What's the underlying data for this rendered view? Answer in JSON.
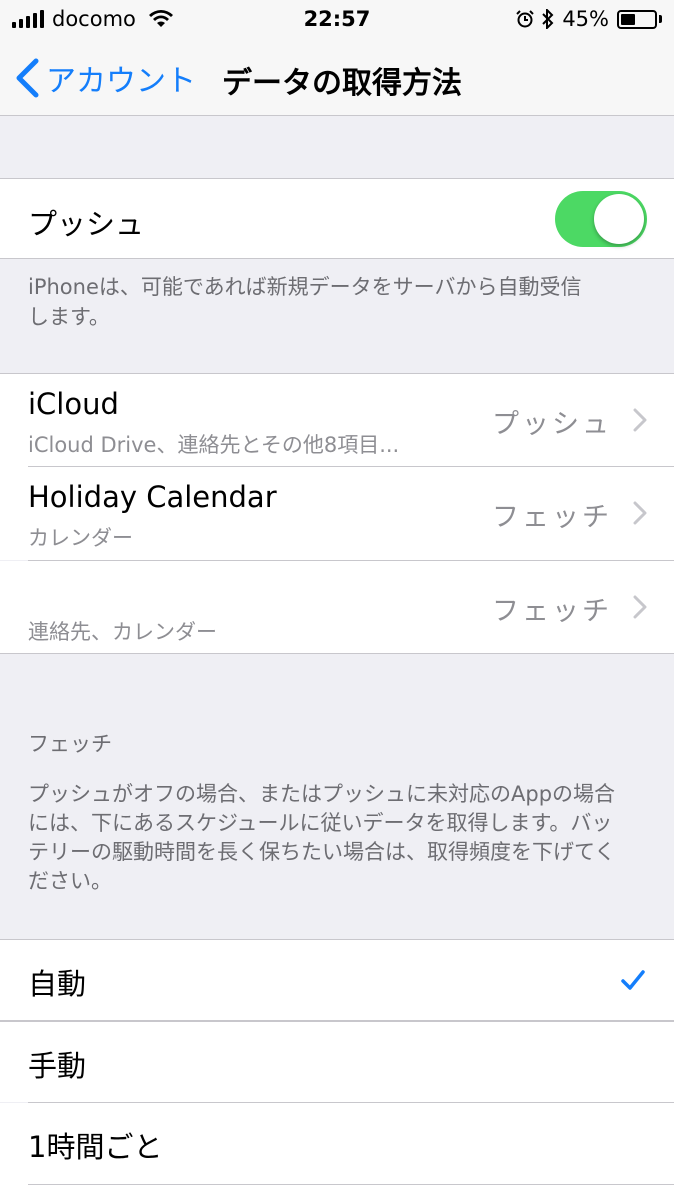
{
  "status_bar": {
    "carrier": "docomo",
    "time": "22:57",
    "battery_percent": "45%",
    "battery_level": 0.45
  },
  "nav": {
    "back_label": "アカウント",
    "title": "データの取得方法"
  },
  "push": {
    "label": "プッシュ",
    "enabled": true,
    "footnote_line1": "iPhoneは、可能であれば新規データをサーバから自動受信",
    "footnote_line2": "します。"
  },
  "accounts": [
    {
      "title": "iCloud",
      "subtitle": "iCloud Drive、連絡先とその他8項目...",
      "value": "プッシュ"
    },
    {
      "title": "Holiday Calendar",
      "subtitle": "カレンダー",
      "value": "フェッチ"
    },
    {
      "title": "",
      "subtitle": "連絡先、カレンダー",
      "value": "フェッチ"
    }
  ],
  "fetch": {
    "header": "フェッチ",
    "description_lines": [
      "プッシュがオフの場合、またはプッシュに未対応のAppの場合",
      "には、下にあるスケジュールに従いデータを取得します。バッ",
      "テリーの駆動時間を長く保ちたい場合は、取得頻度を下げてく",
      "ださい。"
    ],
    "options": [
      {
        "label": "自動",
        "selected": true
      },
      {
        "label": "手動",
        "selected": false
      },
      {
        "label": "1時間ごと",
        "selected": false
      }
    ]
  },
  "colors": {
    "accent": "#147efb",
    "toggle_on": "#4cd964",
    "background": "#efeff4"
  }
}
